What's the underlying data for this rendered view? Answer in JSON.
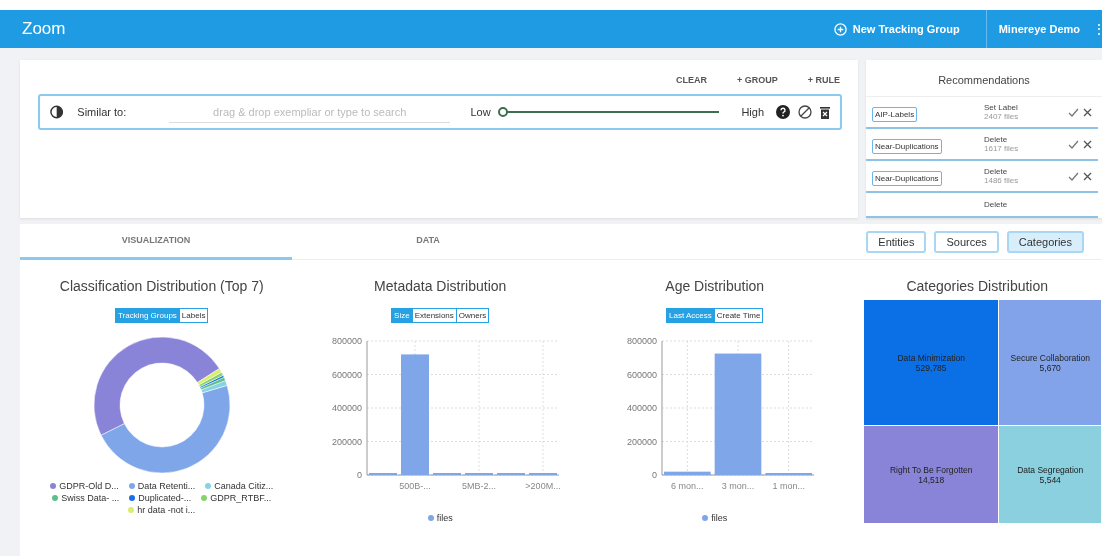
{
  "header": {
    "title": "Zoom",
    "new_group": "New Tracking Group",
    "user": "Minereye Demo",
    "more": "⋮"
  },
  "query": {
    "actions": [
      "CLEAR",
      "+ GROUP",
      "+ RULE"
    ],
    "label": "Similar to:",
    "placeholder": "drag & drop exempliar or type to search",
    "low": "Low",
    "high": "High",
    "level": 0
  },
  "recommendations": {
    "title": "Recommendations",
    "items": [
      {
        "tag": "AIP-Labels",
        "action": "Set Label",
        "count": "2407 files"
      },
      {
        "tag": "Near-Duplications",
        "action": "Delete",
        "count": "1617 files"
      },
      {
        "tag": "Near-Duplications",
        "action": "Delete",
        "count": "1486 files"
      },
      {
        "action": "Delete"
      }
    ]
  },
  "tabs": [
    {
      "label": "VISUALIZATION",
      "selected": true
    },
    {
      "label": "DATA",
      "selected": false
    }
  ],
  "views": [
    {
      "label": "Entities",
      "selected": false
    },
    {
      "label": "Sources",
      "selected": false
    },
    {
      "label": "Categories",
      "selected": true
    }
  ],
  "classification": {
    "title": "Classification Distribution (Top 7)",
    "toggles": [
      {
        "label": "Tracking Groups",
        "selected": true
      },
      {
        "label": "Labels",
        "selected": false
      }
    ],
    "chart_data": {
      "type": "donut",
      "categories": [
        "GDPR-Old D...",
        "Data Retenti...",
        "Canada Citiz...",
        "Swiss Data- ...",
        "Duplicated-...",
        "GDPR_RTBF...",
        "hr data -not i..."
      ],
      "values": [
        48,
        47,
        1.2,
        0.8,
        0.5,
        0.8,
        1
      ],
      "colors": [
        "#8a84d8",
        "#80a6ea",
        "#86d3e3",
        "#5cbf8c",
        "#1a6fe3",
        "#86d46e",
        "#d8ee6c"
      ]
    }
  },
  "metadata": {
    "title": "Metadata Distribution",
    "toggles": [
      {
        "label": "Size",
        "selected": true
      },
      {
        "label": "Extensions",
        "selected": false
      },
      {
        "label": "Owners",
        "selected": false
      }
    ],
    "chart_data": {
      "type": "bar",
      "grid": true,
      "categories": [
        null,
        "500B-...",
        null,
        "5MB-2...",
        null,
        ">200M..."
      ],
      "series": [
        {
          "name": "files",
          "color": "#80a6ea",
          "values": [
            10000,
            720000,
            6000,
            6000,
            5000,
            5000
          ]
        }
      ],
      "ylim": [
        0,
        800000
      ],
      "yticks": [
        0,
        200000,
        400000,
        600000,
        800000
      ]
    }
  },
  "age": {
    "title": "Age Distribution",
    "toggles": [
      {
        "label": "Last Access",
        "selected": true
      },
      {
        "label": "Create Time",
        "selected": false
      }
    ],
    "chart_data": {
      "type": "bar",
      "grid": true,
      "categories": [
        "6 mon...",
        "3 mon...",
        "1 mon..."
      ],
      "series": [
        {
          "name": "files",
          "color": "#80a6ea",
          "values": [
            20000,
            725000,
            8000
          ]
        }
      ],
      "ylim": [
        0,
        800000
      ],
      "yticks": [
        0,
        200000,
        400000,
        600000,
        800000
      ]
    }
  },
  "categories": {
    "title": "Categories Distribution",
    "tiles": [
      {
        "name": "Data Minimization",
        "value": "529,785",
        "color": "#0b70e6"
      },
      {
        "name": "Right To Be Forgotten",
        "value": "14,518",
        "color": "#8a84d8"
      },
      {
        "name": "Secure Collaboration",
        "value": "5,670",
        "color": "#82a3ea"
      },
      {
        "name": "Data Segregation",
        "value": "5,544",
        "color": "#8ad0df"
      }
    ]
  }
}
